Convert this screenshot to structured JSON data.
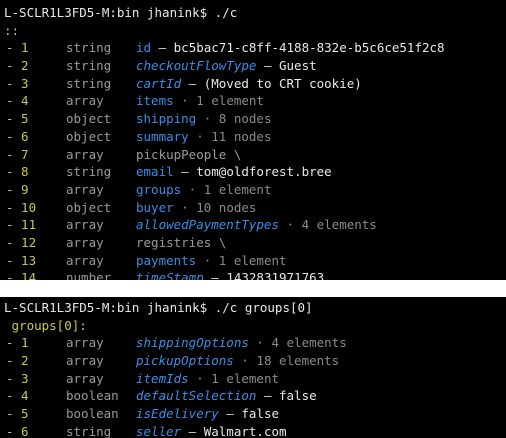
{
  "session1": {
    "prompt": "L-SCLR1L3FD5-M:bin jhanink$ ./c",
    "header": "::",
    "rows": [
      {
        "num": "- 1",
        "type": "string",
        "key": "id",
        "sep": " – ",
        "value": "bc5bac71-c8ff-4188-832e-b5c6ce51f2c8",
        "meta": ""
      },
      {
        "num": "- 2",
        "type": "string",
        "key": "checkoutFlowType",
        "sep": " – ",
        "value": "Guest",
        "meta": ""
      },
      {
        "num": "- 3",
        "type": "string",
        "key": "cartId",
        "sep": " – ",
        "value": "(Moved to CRT cookie)",
        "meta": ""
      },
      {
        "num": "- 4",
        "type": "array",
        "key": "items",
        "sep": "",
        "value": "",
        "meta": " · 1 element"
      },
      {
        "num": "- 5",
        "type": "object",
        "key": "shipping",
        "sep": "",
        "value": "",
        "meta": " · 8 nodes"
      },
      {
        "num": "- 6",
        "type": "object",
        "key": "summary",
        "sep": "",
        "value": "",
        "meta": " · 11 nodes"
      },
      {
        "num": "- 7",
        "type": "array",
        "key": "pickupPeople \\",
        "sep": "",
        "value": "",
        "meta": ""
      },
      {
        "num": "- 8",
        "type": "string",
        "key": "email",
        "sep": " – ",
        "value": "tom@oldforest.bree",
        "meta": ""
      },
      {
        "num": "- 9",
        "type": "array",
        "key": "groups",
        "sep": "",
        "value": "",
        "meta": " · 1 element"
      },
      {
        "num": "- 10",
        "type": "object",
        "key": "buyer",
        "sep": "",
        "value": "",
        "meta": " · 10 nodes"
      },
      {
        "num": "- 11",
        "type": "array",
        "key": "allowedPaymentTypes",
        "sep": "",
        "value": "",
        "meta": " · 4 elements"
      },
      {
        "num": "- 12",
        "type": "array",
        "key": "registries \\",
        "sep": "",
        "value": "",
        "meta": ""
      },
      {
        "num": "- 13",
        "type": "array",
        "key": "payments",
        "sep": "",
        "value": "",
        "meta": " · 1 element"
      },
      {
        "num": "- 14",
        "type": "number",
        "key": "timeStamp",
        "sep": " – ",
        "value": "1432831971763",
        "meta": ""
      }
    ]
  },
  "session2": {
    "prompt": "L-SCLR1L3FD5-M:bin jhanink$ ./c groups[0]",
    "header": " groups[0]:",
    "rows": [
      {
        "num": "- 1",
        "type": "array",
        "key": "shippingOptions",
        "sep": "",
        "value": "",
        "meta": " · 4 elements"
      },
      {
        "num": "- 2",
        "type": "array",
        "key": "pickupOptions",
        "sep": "",
        "value": "",
        "meta": " · 18 elements"
      },
      {
        "num": "- 3",
        "type": "array",
        "key": "itemIds",
        "sep": "",
        "value": "",
        "meta": " · 1 element"
      },
      {
        "num": "- 4",
        "type": "boolean",
        "key": "defaultSelection",
        "sep": " – ",
        "value": "false",
        "meta": ""
      },
      {
        "num": "- 5",
        "type": "boolean",
        "key": "isEdelivery",
        "sep": " – ",
        "value": "false",
        "meta": ""
      },
      {
        "num": "- 6",
        "type": "string",
        "key": "seller",
        "sep": " – ",
        "value": "Walmart.com",
        "meta": ""
      }
    ]
  }
}
